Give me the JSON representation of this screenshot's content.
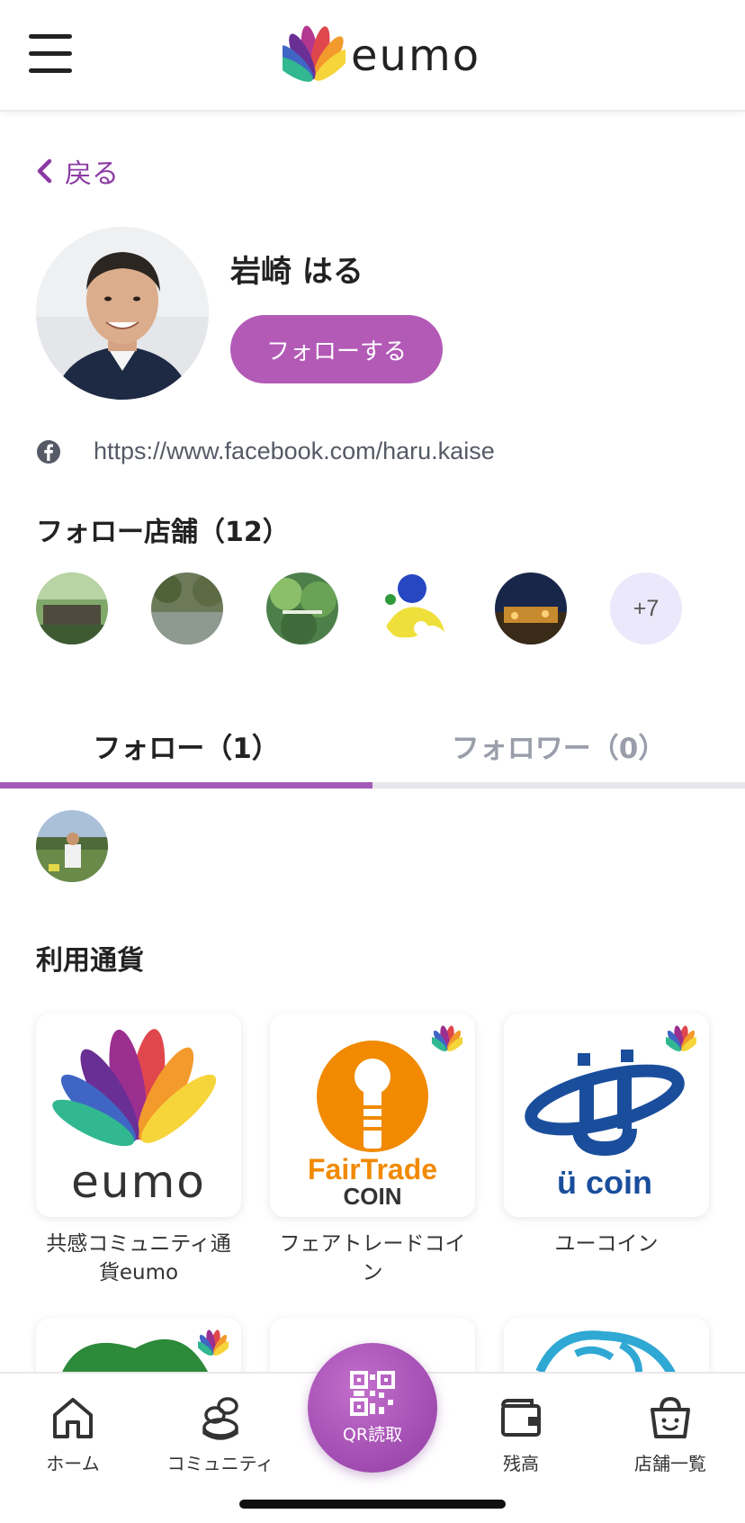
{
  "header": {
    "logo_text": "eumo"
  },
  "back": {
    "label": "戻る"
  },
  "profile": {
    "name": "岩崎 はる",
    "follow_button": "フォローする",
    "facebook_url": "https://www.facebook.com/haru.kaise"
  },
  "followed_stores": {
    "title": "フォロー店舗（12）",
    "more": "+7"
  },
  "tabs": [
    {
      "label": "フォロー（1）",
      "active": true
    },
    {
      "label": "フォロワー（0）",
      "active": false
    }
  ],
  "currencies": {
    "title": "利用通貨",
    "items": [
      {
        "name": "共感コミュニティ通貨eumo"
      },
      {
        "name": "フェアトレードコイン",
        "logo_text_1": "FairTrade",
        "logo_text_2": "COIN"
      },
      {
        "name": "ユーコイン",
        "logo_text": "ü coin"
      }
    ]
  },
  "bottom_nav": {
    "home": "ホーム",
    "community": "コミュニティ",
    "qr": "QR読取",
    "balance": "残高",
    "stores": "店舗一覧"
  },
  "colors": {
    "accent": "#a45bb8",
    "follow_button": "#b35ab7",
    "back_link": "#8b3aa3"
  }
}
